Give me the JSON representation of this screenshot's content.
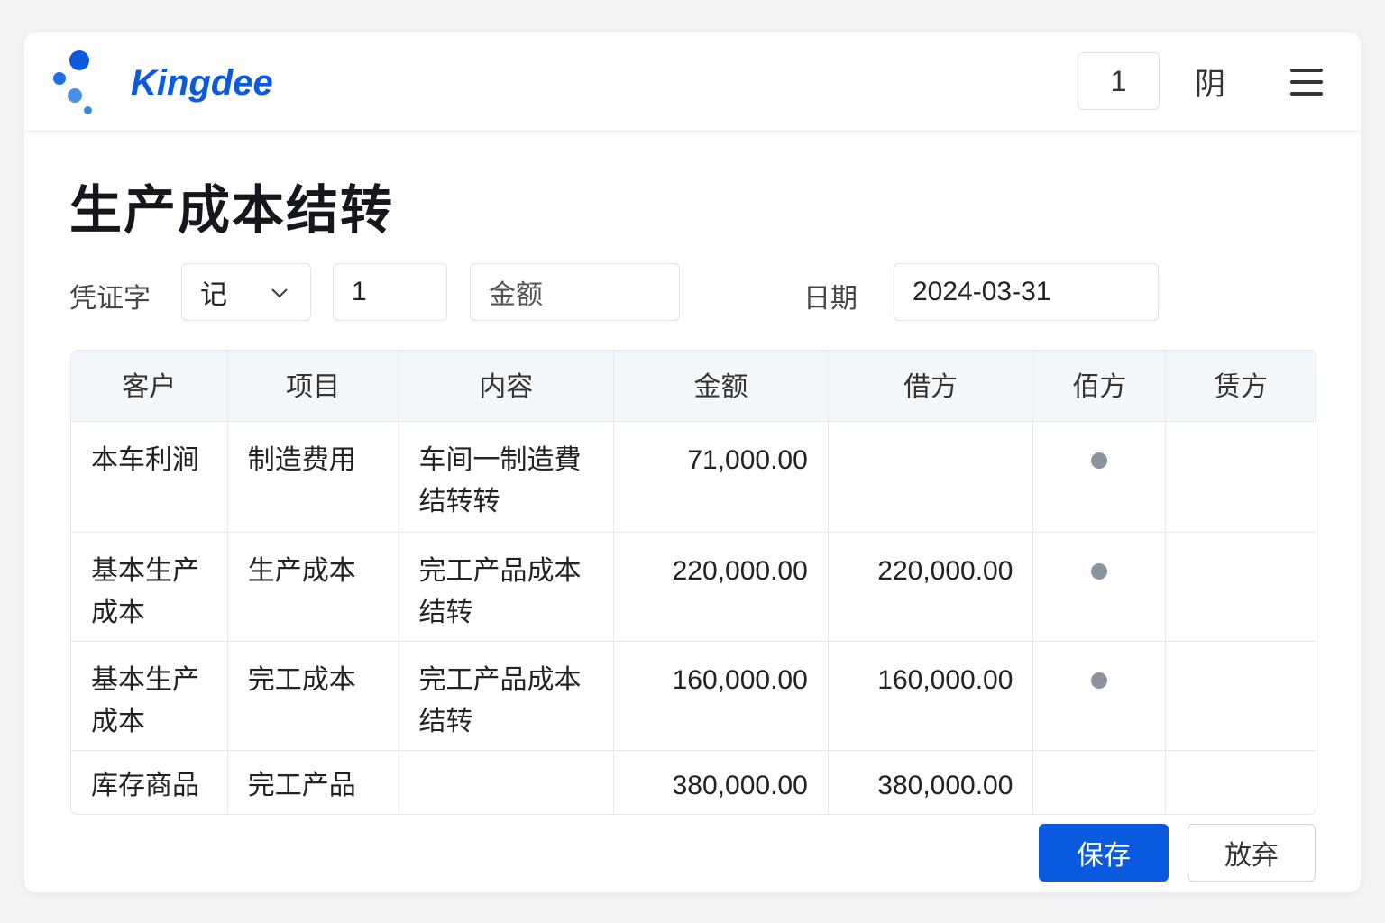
{
  "header": {
    "brand": "Kingdee",
    "page_number": "1",
    "icon_glyph": "阴",
    "colors": {
      "brand": "#0a5ae0",
      "primary": "#0a5ae0"
    }
  },
  "title": "生产成本结转",
  "form": {
    "voucher_label": "凭证字",
    "voucher_type": "记",
    "voucher_number": "1",
    "amount_placeholder": "金额",
    "date_label": "日期",
    "date": "2024-03-31"
  },
  "table": {
    "columns": [
      "客户",
      "项目",
      "内容",
      "金额",
      "借方",
      "佰方",
      "赁方"
    ],
    "rows": [
      {
        "customer": "本车利涧",
        "item": "制造费用",
        "content": "车间一制造費结转转",
        "amount": "71,000.00",
        "debit": "",
        "marked": true
      },
      {
        "customer": "基本生产成本",
        "item": "生产成本",
        "content": "完工产品成本结转",
        "amount": "220,000.00",
        "debit": "220,000.00",
        "marked": true
      },
      {
        "customer": "基本生产成本",
        "item": "完工成本",
        "content": "完工产品成本结转",
        "amount": "160,000.00",
        "debit": "160,000.00",
        "marked": true
      },
      {
        "customer": "库存商品",
        "item": "完工产品",
        "content": "",
        "amount": "380,000.00",
        "debit": "380,000.00",
        "marked": false
      }
    ]
  },
  "actions": {
    "save": "保存",
    "discard": "放弃"
  }
}
